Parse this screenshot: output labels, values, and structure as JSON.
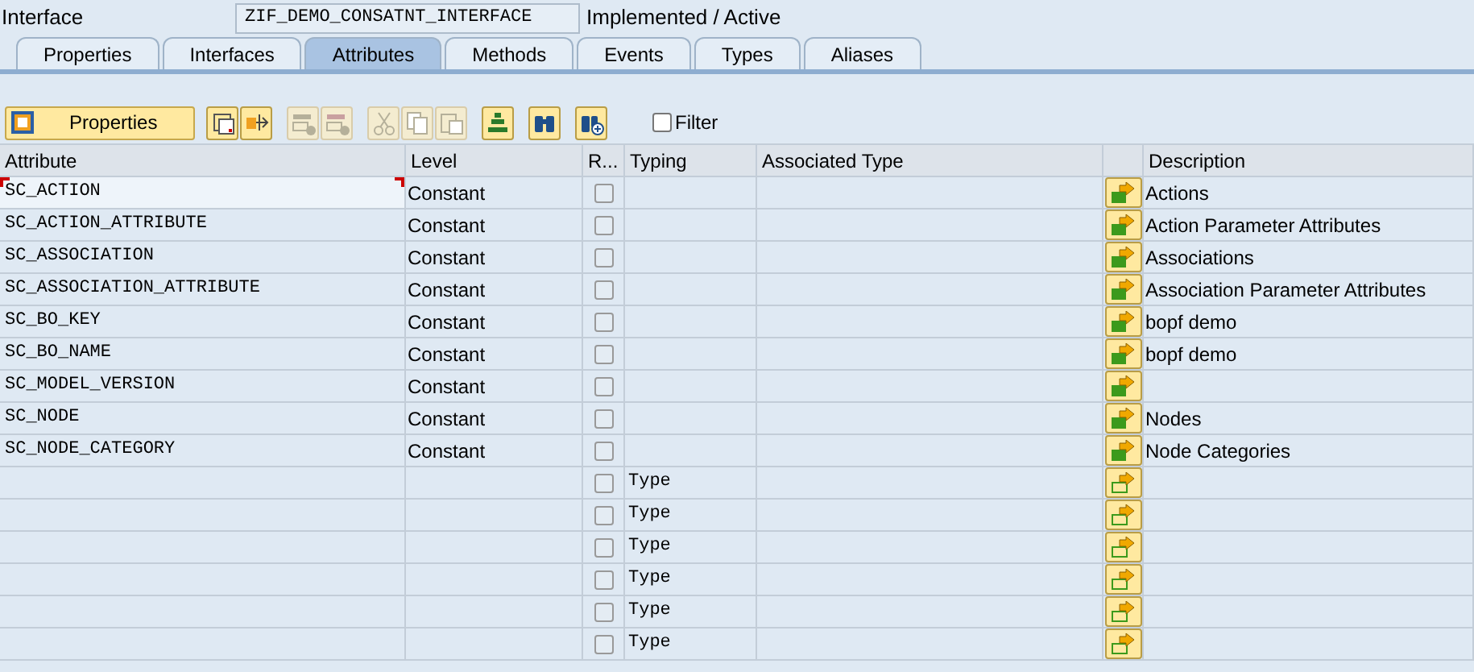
{
  "header": {
    "label": "Interface",
    "name": "ZIF_DEMO_CONSATNT_INTERFACE",
    "status": "Implemented / Active"
  },
  "tabs": [
    {
      "label": "Properties",
      "selected": false
    },
    {
      "label": "Interfaces",
      "selected": false
    },
    {
      "label": "Attributes",
      "selected": true
    },
    {
      "label": "Methods",
      "selected": false
    },
    {
      "label": "Events",
      "selected": false
    },
    {
      "label": "Types",
      "selected": false
    },
    {
      "label": "Aliases",
      "selected": false
    }
  ],
  "toolbar": {
    "properties_button": "Properties",
    "tools": [
      {
        "kind": "details",
        "disabled": false
      },
      {
        "kind": "navigate",
        "disabled": false
      },
      {
        "kind": "insert-row",
        "disabled": true
      },
      {
        "kind": "delete-row",
        "disabled": true
      },
      {
        "kind": "cut",
        "disabled": true
      },
      {
        "kind": "copy",
        "disabled": true
      },
      {
        "kind": "paste",
        "disabled": true
      },
      {
        "kind": "sort",
        "disabled": false
      },
      {
        "kind": "find",
        "disabled": false
      },
      {
        "kind": "find-next",
        "disabled": false
      }
    ],
    "filter": {
      "label": "Filter",
      "checked": false
    }
  },
  "table": {
    "columns": [
      "Attribute",
      "Level",
      "R...",
      "Typing",
      "Associated Type",
      "Description"
    ],
    "rows": [
      {
        "kind": "attribute",
        "attribute": "SC_ACTION",
        "level": "Constant",
        "read_only": false,
        "typing": "",
        "description": "Actions",
        "selected": true
      },
      {
        "kind": "attribute",
        "attribute": "SC_ACTION_ATTRIBUTE",
        "level": "Constant",
        "read_only": false,
        "typing": "",
        "description": "Action Parameter Attributes",
        "selected": false
      },
      {
        "kind": "attribute",
        "attribute": "SC_ASSOCIATION",
        "level": "Constant",
        "read_only": false,
        "typing": "",
        "description": "Associations",
        "selected": false
      },
      {
        "kind": "attribute",
        "attribute": "SC_ASSOCIATION_ATTRIBUTE",
        "level": "Constant",
        "read_only": false,
        "typing": "",
        "description": "Association Parameter Attributes",
        "selected": false
      },
      {
        "kind": "attribute",
        "attribute": "SC_BO_KEY",
        "level": "Constant",
        "read_only": false,
        "typing": "",
        "description": "bopf demo",
        "selected": false
      },
      {
        "kind": "attribute",
        "attribute": "SC_BO_NAME",
        "level": "Constant",
        "read_only": false,
        "typing": "",
        "description": "bopf demo",
        "selected": false
      },
      {
        "kind": "attribute",
        "attribute": "SC_MODEL_VERSION",
        "level": "Constant",
        "read_only": false,
        "typing": "",
        "description": "",
        "selected": false
      },
      {
        "kind": "attribute",
        "attribute": "SC_NODE",
        "level": "Constant",
        "read_only": false,
        "typing": "",
        "description": "Nodes",
        "selected": false
      },
      {
        "kind": "attribute",
        "attribute": "SC_NODE_CATEGORY",
        "level": "Constant",
        "read_only": false,
        "typing": "",
        "description": "Node Categories",
        "selected": false
      },
      {
        "kind": "empty",
        "attribute": "",
        "level": "",
        "read_only": false,
        "typing": "Type",
        "description": "",
        "selected": false
      },
      {
        "kind": "empty",
        "attribute": "",
        "level": "",
        "read_only": false,
        "typing": "Type",
        "description": "",
        "selected": false
      },
      {
        "kind": "empty",
        "attribute": "",
        "level": "",
        "read_only": false,
        "typing": "Type",
        "description": "",
        "selected": false
      },
      {
        "kind": "empty",
        "attribute": "",
        "level": "",
        "read_only": false,
        "typing": "Type",
        "description": "",
        "selected": false
      },
      {
        "kind": "empty",
        "attribute": "",
        "level": "",
        "read_only": false,
        "typing": "Type",
        "description": "",
        "selected": false
      },
      {
        "kind": "empty",
        "attribute": "",
        "level": "",
        "read_only": false,
        "typing": "Type",
        "description": "",
        "selected": false
      }
    ]
  }
}
